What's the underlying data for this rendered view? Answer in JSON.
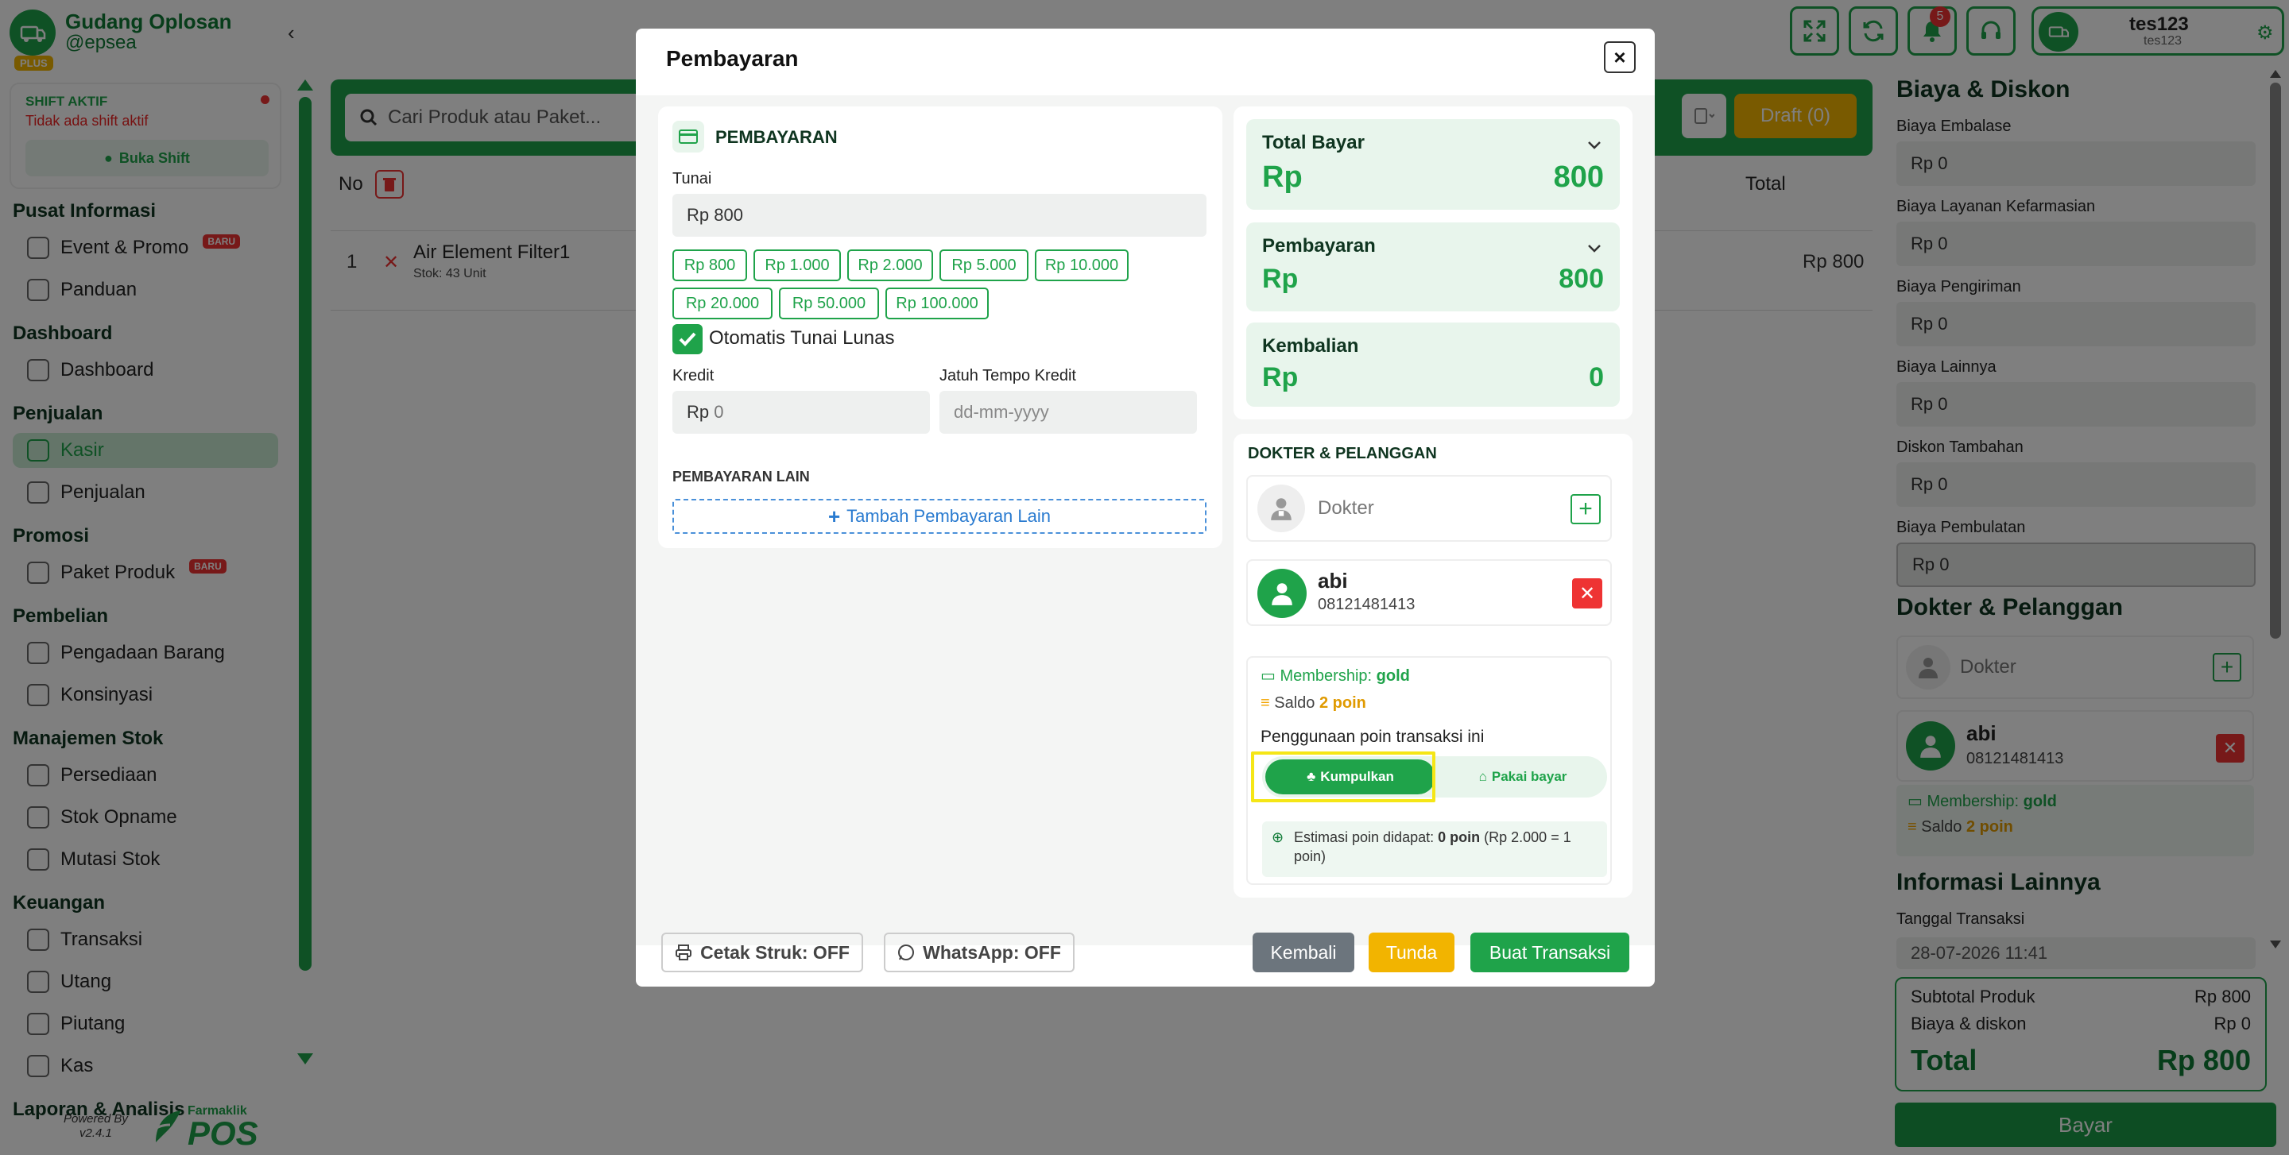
{
  "sidebar": {
    "brand_name": "Gudang Oplosan",
    "brand_user": "@epsea",
    "plan_badge": "PLUS",
    "shift": {
      "title": "SHIFT AKTIF",
      "message": "Tidak ada shift aktif",
      "button": "Buka Shift"
    },
    "sections": [
      {
        "title": "Pusat Informasi",
        "items": [
          {
            "label": "Event & Promo",
            "badge": "BARU"
          },
          {
            "label": "Panduan"
          }
        ]
      },
      {
        "title": "Dashboard",
        "items": [
          {
            "label": "Dashboard"
          }
        ]
      },
      {
        "title": "Penjualan",
        "items": [
          {
            "label": "Kasir",
            "active": true
          },
          {
            "label": "Penjualan"
          }
        ]
      },
      {
        "title": "Promosi",
        "items": [
          {
            "label": "Paket Produk",
            "badge": "BARU"
          }
        ]
      },
      {
        "title": "Pembelian",
        "items": [
          {
            "label": "Pengadaan Barang"
          },
          {
            "label": "Konsinyasi"
          }
        ]
      },
      {
        "title": "Manajemen Stok",
        "items": [
          {
            "label": "Persediaan"
          },
          {
            "label": "Stok Opname"
          },
          {
            "label": "Mutasi Stok"
          }
        ]
      },
      {
        "title": "Keuangan",
        "items": [
          {
            "label": "Transaksi"
          },
          {
            "label": "Utang"
          },
          {
            "label": "Piutang"
          },
          {
            "label": "Kas"
          }
        ]
      },
      {
        "title": "Laporan & Analisis",
        "items": []
      }
    ],
    "powered_by": "Powered By",
    "version": "v2.4.1",
    "logo_top": "Farmaklik",
    "logo_bottom": "POS"
  },
  "topbar": {
    "notification_count": "5",
    "user_name": "tes123",
    "user_sub": "tes123"
  },
  "cart": {
    "search_placeholder": "Cari Produk atau Paket...",
    "draft_label": "Draft (0)",
    "columns": {
      "no": "No",
      "total": "Total"
    },
    "rows": [
      {
        "no": "1",
        "name": "Air Element Filter1",
        "stock": "Stok: 43 Unit",
        "total": "Rp 800"
      }
    ]
  },
  "right_panel": {
    "title_biaya": "Biaya & Diskon",
    "fields": [
      {
        "label": "Biaya Embalase",
        "value": "Rp 0"
      },
      {
        "label": "Biaya Layanan Kefarmasian",
        "value": "Rp 0"
      },
      {
        "label": "Biaya Pengiriman",
        "value": "Rp 0"
      },
      {
        "label": "Biaya Lainnya",
        "value": "Rp 0"
      },
      {
        "label": "Diskon Tambahan",
        "value": "Rp 0"
      },
      {
        "label": "Biaya Pembulatan",
        "value": "Rp 0"
      }
    ],
    "title_dokter": "Dokter & Pelanggan",
    "dokter_placeholder": "Dokter",
    "customer_name": "abi",
    "customer_phone": "08121481413",
    "membership_label": "Membership:",
    "membership_value": "gold",
    "saldo_label": "Saldo",
    "saldo_value": "2 poin",
    "title_info": "Informasi Lainnya",
    "tanggal_label": "Tanggal Transaksi",
    "tanggal_value": "28-07-2026 11:41",
    "summary": {
      "subtotal_label": "Subtotal Produk",
      "subtotal_value": "Rp 800",
      "biaya_label": "Biaya & diskon",
      "biaya_value": "Rp 0",
      "total_label": "Total",
      "total_value": "Rp 800"
    },
    "bayar_label": "Bayar"
  },
  "modal": {
    "title": "Pembayaran",
    "close": "×",
    "payment": {
      "header": "PEMBAYARAN",
      "tunai_label": "Tunai",
      "tunai_value": "Rp 800",
      "quick_amounts": [
        "Rp 800",
        "Rp 1.000",
        "Rp 2.000",
        "Rp 5.000",
        "Rp 10.000",
        "Rp 20.000",
        "Rp 50.000",
        "Rp 100.000"
      ],
      "auto_lunas_label": "Otomatis Tunai Lunas",
      "kredit_label": "Kredit",
      "kredit_prefix": "Rp",
      "kredit_value": "0",
      "jatuh_tempo_label": "Jatuh Tempo Kredit",
      "jatuh_tempo_placeholder": "dd-mm-yyyy",
      "lain_title": "PEMBAYARAN LAIN",
      "tambah_label": "Tambah Pembayaran Lain"
    },
    "summary": [
      {
        "label": "Total Bayar",
        "currency": "Rp",
        "value": "800"
      },
      {
        "label": "Pembayaran",
        "currency": "Rp",
        "value": "800"
      },
      {
        "label": "Kembalian",
        "currency": "Rp",
        "value": "0"
      }
    ],
    "dokter_pelanggan": {
      "title": "DOKTER & PELANGGAN",
      "dokter_placeholder": "Dokter",
      "customer_name": "abi",
      "customer_phone": "08121481413",
      "membership_label": "Membership:",
      "membership_value": "gold",
      "saldo_label": "Saldo",
      "saldo_value": "2 poin",
      "poin_usage_label": "Penggunaan poin transaksi ini",
      "kumpulkan_label": "Kumpulkan",
      "pakai_label": "Pakai bayar",
      "estimasi_prefix": "Estimasi poin didapat:",
      "estimasi_value": "0 poin",
      "estimasi_rate": "(Rp 2.000 = 1 poin)"
    },
    "footer": {
      "cetak_label": "Cetak Struk: OFF",
      "whatsapp_label": "WhatsApp: OFF",
      "kembali_label": "Kembali",
      "tunda_label": "Tunda",
      "buat_label": "Buat Transaksi"
    }
  },
  "colors": {
    "primary": "#1fa34a",
    "danger": "#e33333",
    "warning": "#f2b400",
    "highlight": "#f5e616",
    "muted_button": "#6c757d"
  }
}
